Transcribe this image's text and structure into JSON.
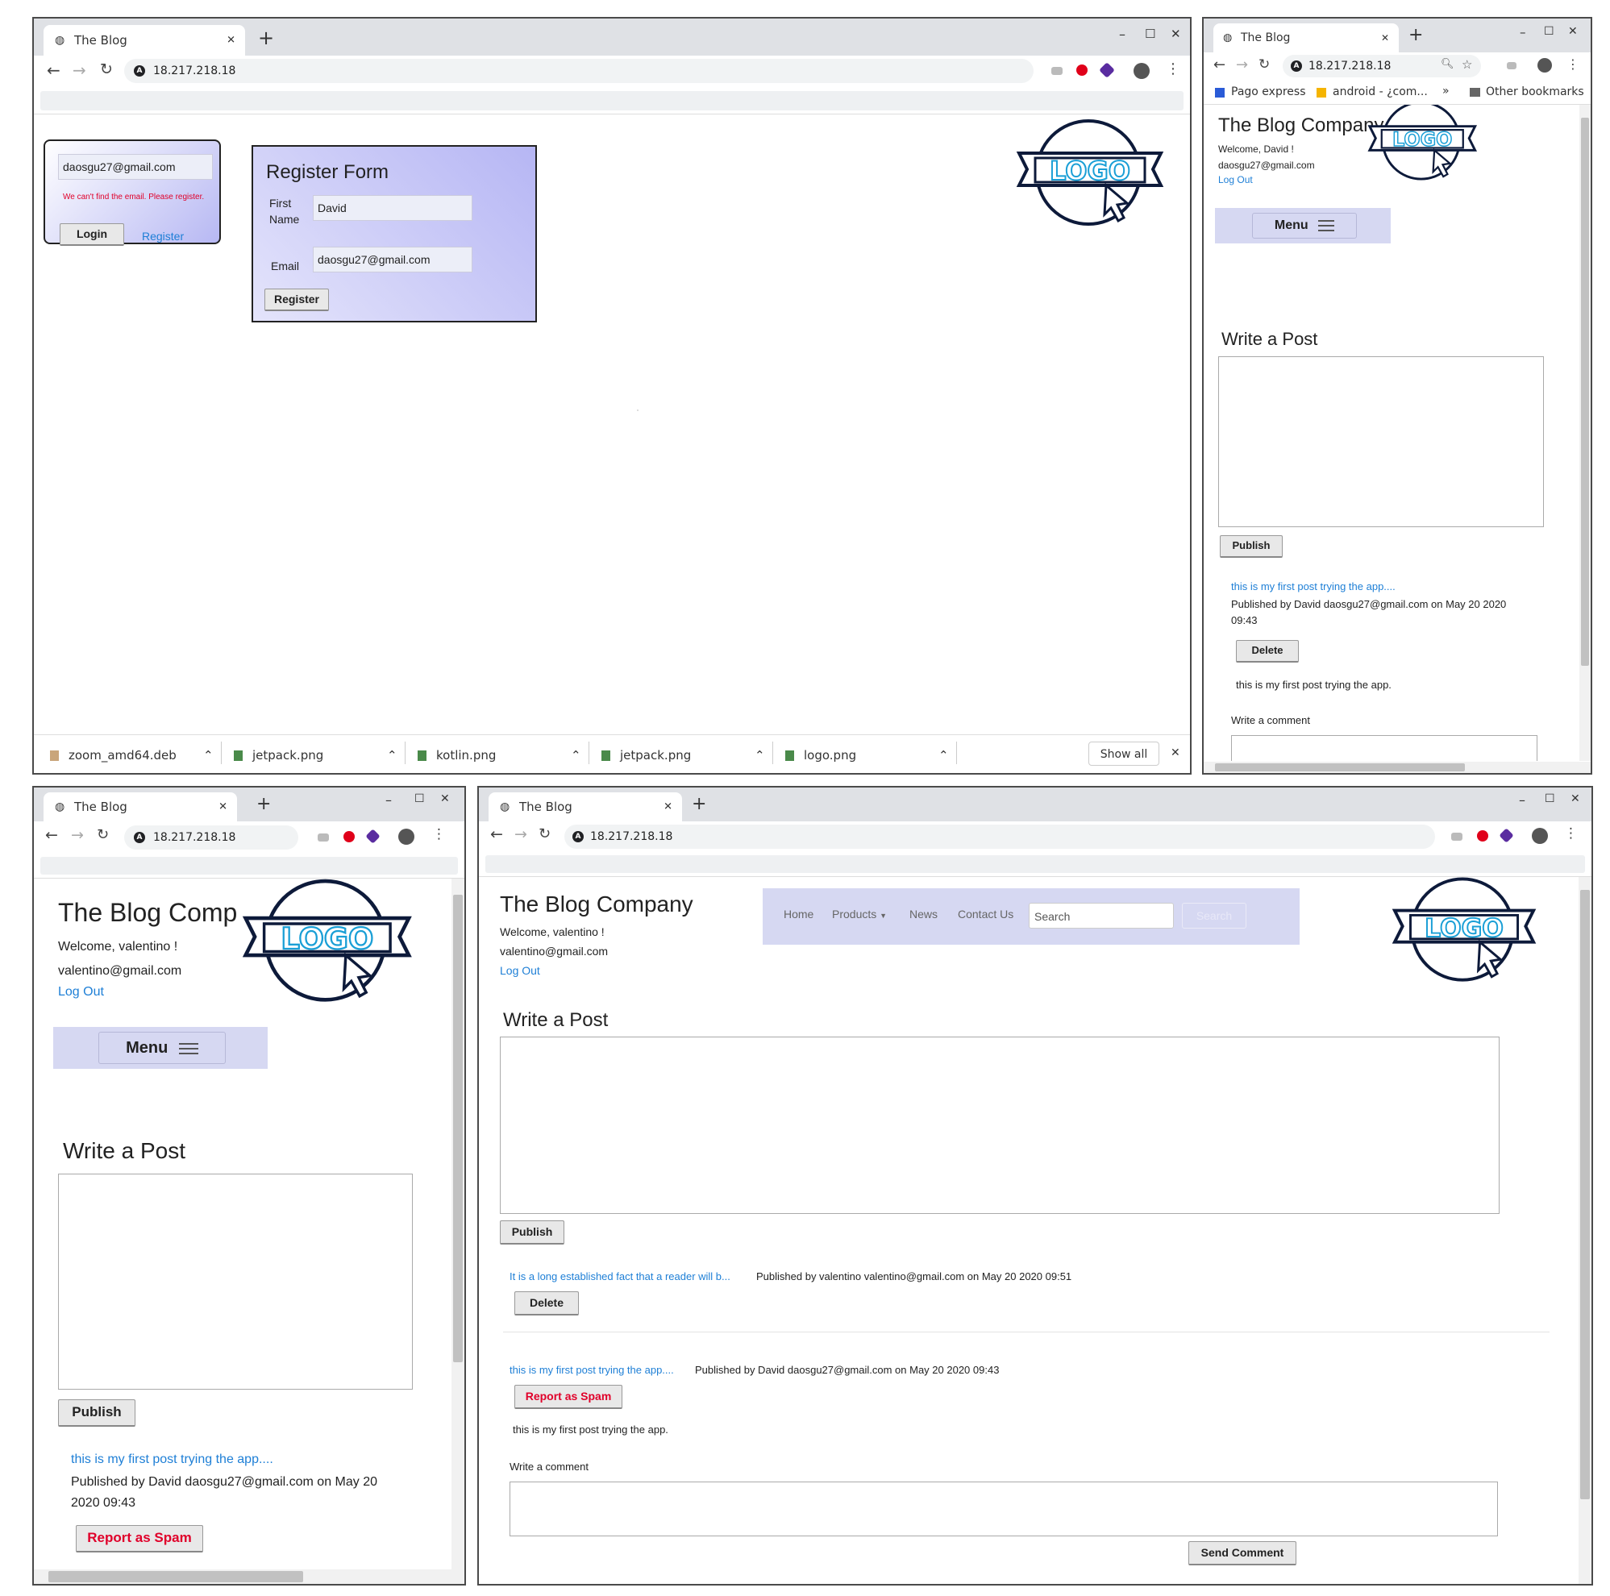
{
  "browser": {
    "tab_title": "The Blog",
    "new_tab": "+",
    "url": "18.217.218.18",
    "minimize": "–",
    "maximize": "☐",
    "close": "✕",
    "tab_close": "✕",
    "menu_dots": "⋮"
  },
  "w1": {
    "login": {
      "email_value": "daosgu27@gmail.com",
      "error": "We can't find the email. Please register.",
      "login_button": "Login",
      "register_link": "Register"
    },
    "register": {
      "title": "Register Form",
      "first_name_label_1": "First",
      "first_name_label_2": "Name",
      "first_name_value": "David",
      "email_label": "Email",
      "email_value": "daosgu27@gmail.com",
      "register_button": "Register"
    },
    "logo_text": "LOGO",
    "downloads": [
      {
        "name": "zoom_amd64.deb"
      },
      {
        "name": "jetpack.png"
      },
      {
        "name": "kotlin.png"
      },
      {
        "name": "jetpack.png"
      },
      {
        "name": "logo.png"
      }
    ],
    "show_all": "Show all",
    "close_downloads": "✕"
  },
  "w2": {
    "bookmarks": [
      {
        "label": "Pago express"
      },
      {
        "label": "android - ¿com..."
      }
    ],
    "more_bookmarks": "»",
    "other_bookmarks": "Other bookmarks",
    "company": "The Blog Company",
    "welcome": "Welcome, David !",
    "email": "daosgu27@gmail.com",
    "logout": "Log Out",
    "menu": "Menu",
    "write_post": "Write a Post",
    "publish": "Publish",
    "post_title": "this is my first post trying the app....",
    "post_meta_1": "Published by David daosgu27@gmail.com on May 20 2020",
    "post_meta_2": "09:43",
    "delete": "Delete",
    "post_body": "this is my first post trying the app.",
    "write_comment": "Write a comment",
    "logo_text": "LOGO"
  },
  "w3": {
    "company": "The Blog Comp",
    "welcome": "Welcome, valentino !",
    "email": "valentino@gmail.com",
    "logout": "Log Out",
    "menu": "Menu",
    "write_post": "Write a Post",
    "publish": "Publish",
    "post_title": "this is my first post trying the app....",
    "post_meta_1": "Published by David daosgu27@gmail.com on May 20",
    "post_meta_2": "2020 09:43",
    "report_spam": "Report as Spam",
    "logo_text": "LOGO"
  },
  "w4": {
    "company": "The Blog Company",
    "welcome": "Welcome, valentino !",
    "email": "valentino@gmail.com",
    "logout": "Log Out",
    "nav": {
      "home": "Home",
      "products": "Products",
      "news": "News",
      "contact": "Contact Us",
      "search_placeholder": "Search",
      "search_button": "Search"
    },
    "write_post": "Write a Post",
    "publish": "Publish",
    "post1_title": "It is a long established fact that a reader will b...",
    "post1_meta": "Published by valentino valentino@gmail.com on May 20 2020 09:51",
    "delete": "Delete",
    "post2_title": "this is my first post trying the app....",
    "post2_meta": "Published by David daosgu27@gmail.com on May 20 2020 09:43",
    "report_spam": "Report as Spam",
    "post2_body": "this is my first post trying the app.",
    "write_comment": "Write a comment",
    "send_comment": "Send Comment",
    "logo_text": "LOGO"
  },
  "colors": {
    "link": "#1e7fd6",
    "error": "#e0002a",
    "menu_bg": "#d6d8f2",
    "logo_blue": "#1a9fd6",
    "logo_navy": "#0d1a3a"
  }
}
